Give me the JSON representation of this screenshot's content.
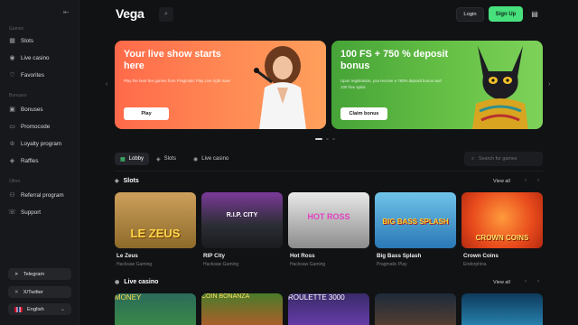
{
  "header": {
    "logo": "Vega",
    "login_label": "Login",
    "signup_label": "Sign Up"
  },
  "sidebar": {
    "games_label": "Games",
    "games_items": [
      {
        "label": "Slots",
        "icon": "slots-icon"
      },
      {
        "label": "Live casino",
        "icon": "live-casino-icon"
      },
      {
        "label": "Favorites",
        "icon": "heart-icon"
      }
    ],
    "bonuses_label": "Bonuses",
    "bonus_items": [
      {
        "label": "Bonuses",
        "icon": "gift-icon"
      },
      {
        "label": "Promocode",
        "icon": "ticket-icon"
      },
      {
        "label": "Loyalty program",
        "icon": "crown-icon"
      },
      {
        "label": "Raffles",
        "icon": "raffle-icon"
      }
    ],
    "other_label": "Other",
    "other_items": [
      {
        "label": "Referral program",
        "icon": "referral-icon"
      },
      {
        "label": "Support",
        "icon": "support-icon"
      }
    ],
    "telegram_label": "Telegram",
    "twitter_label": "X/Twitter",
    "language_label": "English"
  },
  "banners": [
    {
      "title": "Your live show starts here",
      "subtitle": "Play the best live games from Pragmatic Play Live right now!",
      "button_label": "Play"
    },
    {
      "title": "100 FS + 750 % deposit bonus",
      "subtitle": "Upon registration, you receive a 750% deposit bonus and 100 free spins",
      "button_label": "Claim bonus"
    }
  ],
  "tabs": [
    {
      "label": "Lobby",
      "icon": "lobby-icon",
      "active": true
    },
    {
      "label": "Slots",
      "icon": "slots-icon",
      "active": false
    },
    {
      "label": "Live casino",
      "icon": "live-casino-icon",
      "active": false
    }
  ],
  "search": {
    "placeholder": "Search for games"
  },
  "slots_section": {
    "title": "Slots",
    "view_all": "View all",
    "games": [
      {
        "title": "Le Zeus",
        "provider": "Hacksaw Gaming",
        "art": "LE ZEUS"
      },
      {
        "title": "RIP City",
        "provider": "Hacksaw Gaming",
        "art": "R.I.P. CITY"
      },
      {
        "title": "Hot Ross",
        "provider": "Hacksaw Gaming",
        "art": "HOT ROSS"
      },
      {
        "title": "Big Bass Splash",
        "provider": "Pragmatic Play",
        "art": "BIG BASS SPLASH"
      },
      {
        "title": "Crown Coins",
        "provider": "Endorphina",
        "art": "CROWN COINS"
      }
    ]
  },
  "live_section": {
    "title": "Live casino",
    "view_all": "View all",
    "games": [
      {
        "art": "MONEY"
      },
      {
        "art": "COIN BONANZA"
      },
      {
        "art": "ROULETTE 3000"
      },
      {
        "art": ""
      },
      {
        "art": ""
      }
    ]
  },
  "pagination": {
    "count": 3,
    "active": 0
  }
}
